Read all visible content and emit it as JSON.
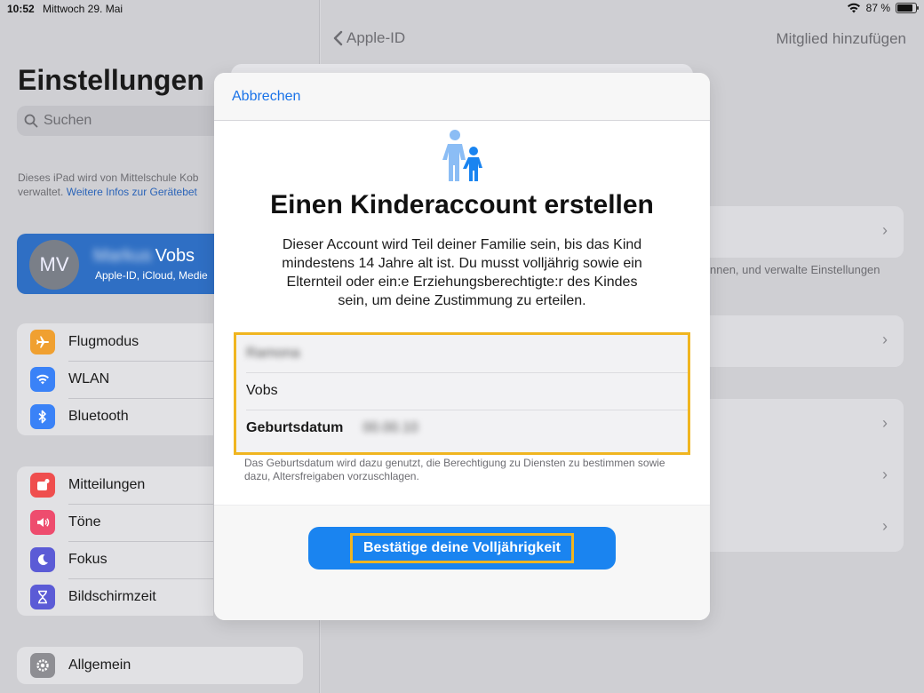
{
  "statusbar": {
    "time": "10:52",
    "date": "Mittwoch 29. Mai",
    "battery": "87 %"
  },
  "sidebar": {
    "title": "Einstellungen",
    "search_placeholder": "Suchen",
    "note_prefix": "Dieses iPad wird von Mittelschule Kob",
    "note_suffix": "verwaltet.",
    "note_link": "Weitere Infos zur Gerätebet",
    "profile": {
      "initials": "MV",
      "first_name_blurred": "Markus",
      "last_name": "Vobs",
      "subtitle": "Apple-ID, iCloud, Medie"
    },
    "group1": [
      {
        "label": "Flugmodus",
        "icon": "airplane-icon",
        "color": "#f0a030"
      },
      {
        "label": "WLAN",
        "icon": "wifi-icon",
        "color": "#3a82f7"
      },
      {
        "label": "Bluetooth",
        "icon": "bluetooth-icon",
        "color": "#3a82f7"
      }
    ],
    "group2": [
      {
        "label": "Mitteilungen",
        "icon": "notification-icon",
        "color": "#ef4e4e"
      },
      {
        "label": "Töne",
        "icon": "speaker-icon",
        "color": "#ee4c6e"
      },
      {
        "label": "Fokus",
        "icon": "moon-icon",
        "color": "#5b5bd6"
      },
      {
        "label": "Bildschirmzeit",
        "icon": "hourglass-icon",
        "color": "#5b5bd6"
      }
    ],
    "group3": [
      {
        "label": "Allgemein",
        "icon": "gear-icon",
        "color": "#8e8e93"
      }
    ]
  },
  "detail": {
    "back_label": "Apple-ID",
    "right_action": "Mitglied hinzufügen",
    "partial_text": "nnen, und verwalte Einstellungen"
  },
  "modal": {
    "cancel_label": "Abbrechen",
    "title": "Einen Kinderaccount erstellen",
    "description": "Dieser Account wird Teil deiner Familie sein, bis das Kind mindestens 14 Jahre alt ist. Du musst volljährig sowie ein Elternteil oder ein:e Erziehungsberechtigte:r des Kindes sein, um deine Zustimmung zu erteilen.",
    "first_name_value": "Ramona",
    "last_name_value": "Vobs",
    "birthdate_label": "Geburtsdatum",
    "birthdate_value": "00.00.10",
    "form_note": "Das Geburtsdatum wird dazu genutzt, die Berechtigung zu Diensten zu bestimmen sowie dazu, Altersfreigaben vorzuschlagen.",
    "confirm_label": "Bestätige deine Volljährigkeit"
  },
  "colors": {
    "accent": "#1a73e8",
    "highlight": "#f0b520",
    "button": "#1a84f0"
  }
}
